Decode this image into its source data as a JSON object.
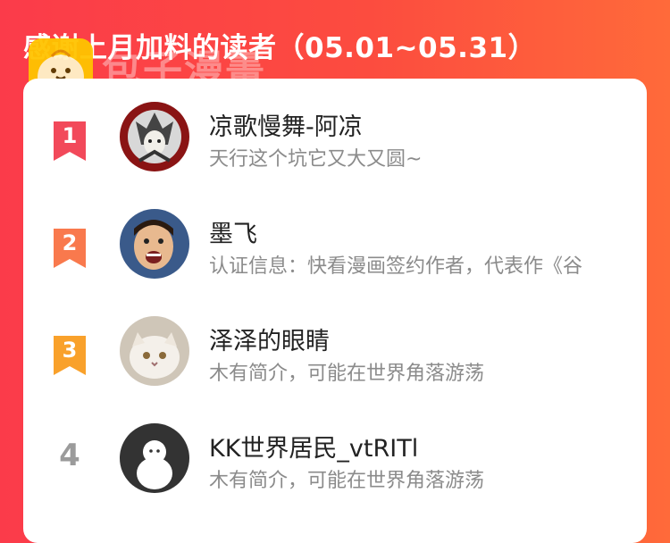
{
  "header": {
    "title": "感谢上月加料的读者（05.01~05.31）",
    "watermark_text": "包子漫畫",
    "logo_icon": "bun-logo-icon"
  },
  "colors": {
    "header_bg": "#fc4540",
    "rank1": "#f2495a",
    "rank2": "#f9794d",
    "rank3": "#f9a12b",
    "rank_plain": "#9b9b9b",
    "name_text": "#222222",
    "desc_text": "#8b8b8b"
  },
  "readers": [
    {
      "rank": "1",
      "name": "凉歌慢舞-阿凉",
      "desc": "天行这个坑它又大又圆~",
      "avatar_icon": "mecha-avatar"
    },
    {
      "rank": "2",
      "name": "墨飞",
      "desc": "认证信息：快看漫画签约作者，代表作《谷",
      "avatar_icon": "man-face-avatar"
    },
    {
      "rank": "3",
      "name": "泽泽的眼睛",
      "desc": "木有简介，可能在世界角落游荡",
      "avatar_icon": "cat-avatar"
    },
    {
      "rank": "4",
      "name": "KK世界居民_vtRITl",
      "desc": "木有简介，可能在世界角落游荡",
      "avatar_icon": "default-user-avatar"
    }
  ]
}
